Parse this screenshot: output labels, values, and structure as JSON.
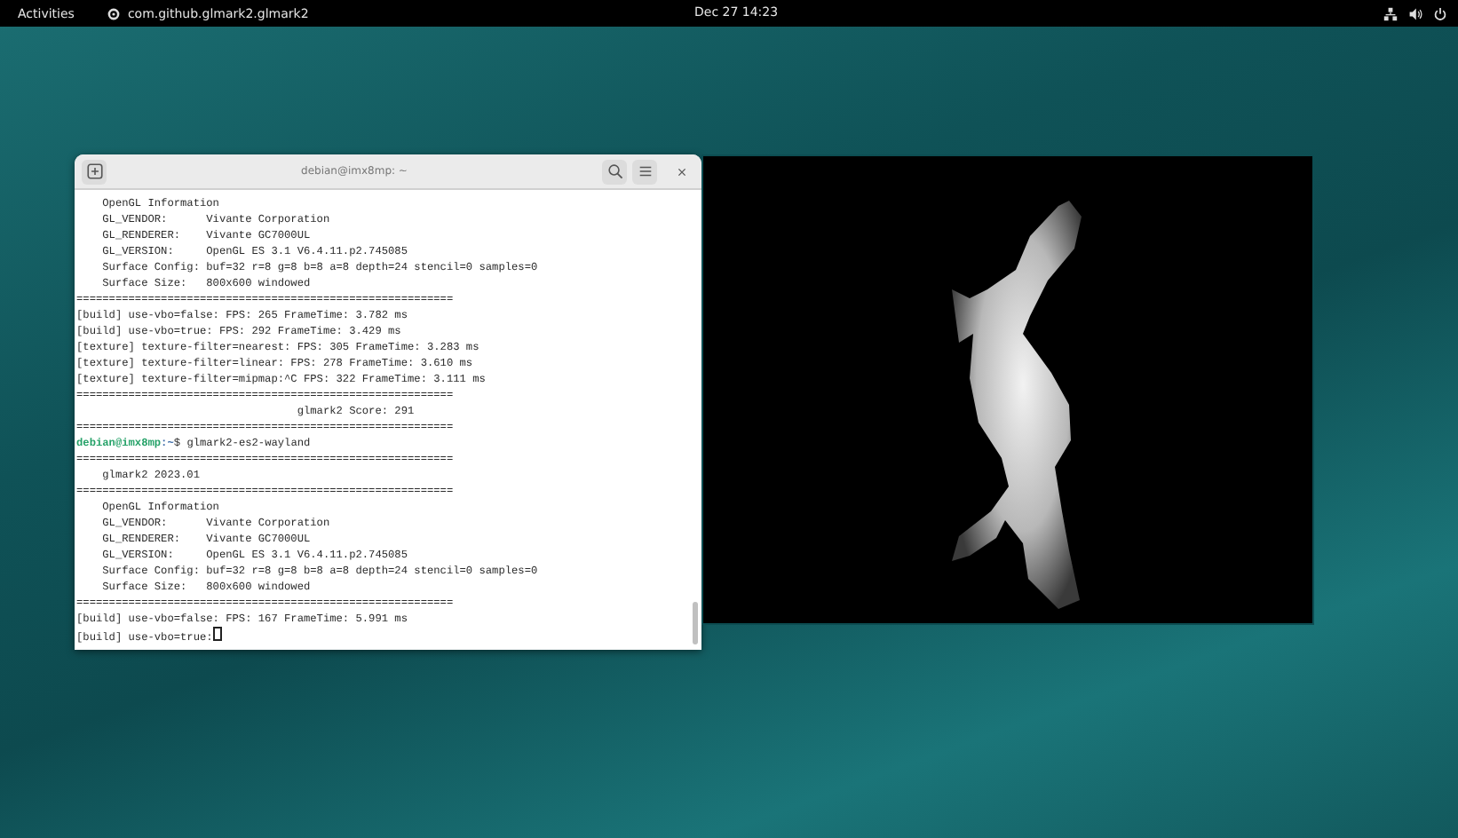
{
  "top_bar": {
    "activities": "Activities",
    "app_name": "com.github.glmark2.glmark2",
    "clock": "Dec 27  14:23"
  },
  "terminal": {
    "title": "debian@imx8mp: ~",
    "lines": [
      {
        "kind": "text",
        "text": "    OpenGL Information"
      },
      {
        "kind": "text",
        "text": "    GL_VENDOR:      Vivante Corporation"
      },
      {
        "kind": "text",
        "text": "    GL_RENDERER:    Vivante GC7000UL"
      },
      {
        "kind": "text",
        "text": "    GL_VERSION:     OpenGL ES 3.1 V6.4.11.p2.745085"
      },
      {
        "kind": "text",
        "text": "    Surface Config: buf=32 r=8 g=8 b=8 a=8 depth=24 stencil=0 samples=0"
      },
      {
        "kind": "text",
        "text": "    Surface Size:   800x600 windowed"
      },
      {
        "kind": "text",
        "text": "=========================================================="
      },
      {
        "kind": "text",
        "text": "[build] use-vbo=false: FPS: 265 FrameTime: 3.782 ms"
      },
      {
        "kind": "text",
        "text": "[build] use-vbo=true: FPS: 292 FrameTime: 3.429 ms"
      },
      {
        "kind": "text",
        "text": "[texture] texture-filter=nearest: FPS: 305 FrameTime: 3.283 ms"
      },
      {
        "kind": "text",
        "text": "[texture] texture-filter=linear: FPS: 278 FrameTime: 3.610 ms"
      },
      {
        "kind": "text",
        "text": "[texture] texture-filter=mipmap:^C FPS: 322 FrameTime: 3.111 ms"
      },
      {
        "kind": "text",
        "text": "=========================================================="
      },
      {
        "kind": "text",
        "text": "                                  glmark2 Score: 291"
      },
      {
        "kind": "text",
        "text": "=========================================================="
      },
      {
        "kind": "prompt",
        "user": "debian@imx8mp",
        "path": ":~",
        "command": "$ glmark2-es2-wayland"
      },
      {
        "kind": "text",
        "text": "=========================================================="
      },
      {
        "kind": "text",
        "text": "    glmark2 2023.01"
      },
      {
        "kind": "text",
        "text": "=========================================================="
      },
      {
        "kind": "text",
        "text": "    OpenGL Information"
      },
      {
        "kind": "text",
        "text": "    GL_VENDOR:      Vivante Corporation"
      },
      {
        "kind": "text",
        "text": "    GL_RENDERER:    Vivante GC7000UL"
      },
      {
        "kind": "text",
        "text": "    GL_VERSION:     OpenGL ES 3.1 V6.4.11.p2.745085"
      },
      {
        "kind": "text",
        "text": "    Surface Config: buf=32 r=8 g=8 b=8 a=8 depth=24 stencil=0 samples=0"
      },
      {
        "kind": "text",
        "text": "    Surface Size:   800x600 windowed"
      },
      {
        "kind": "text",
        "text": "=========================================================="
      },
      {
        "kind": "text",
        "text": "[build] use-vbo=false: FPS: 167 FrameTime: 5.991 ms"
      },
      {
        "kind": "text",
        "text": "[build] use-vbo=true:",
        "cursor": true
      }
    ]
  }
}
